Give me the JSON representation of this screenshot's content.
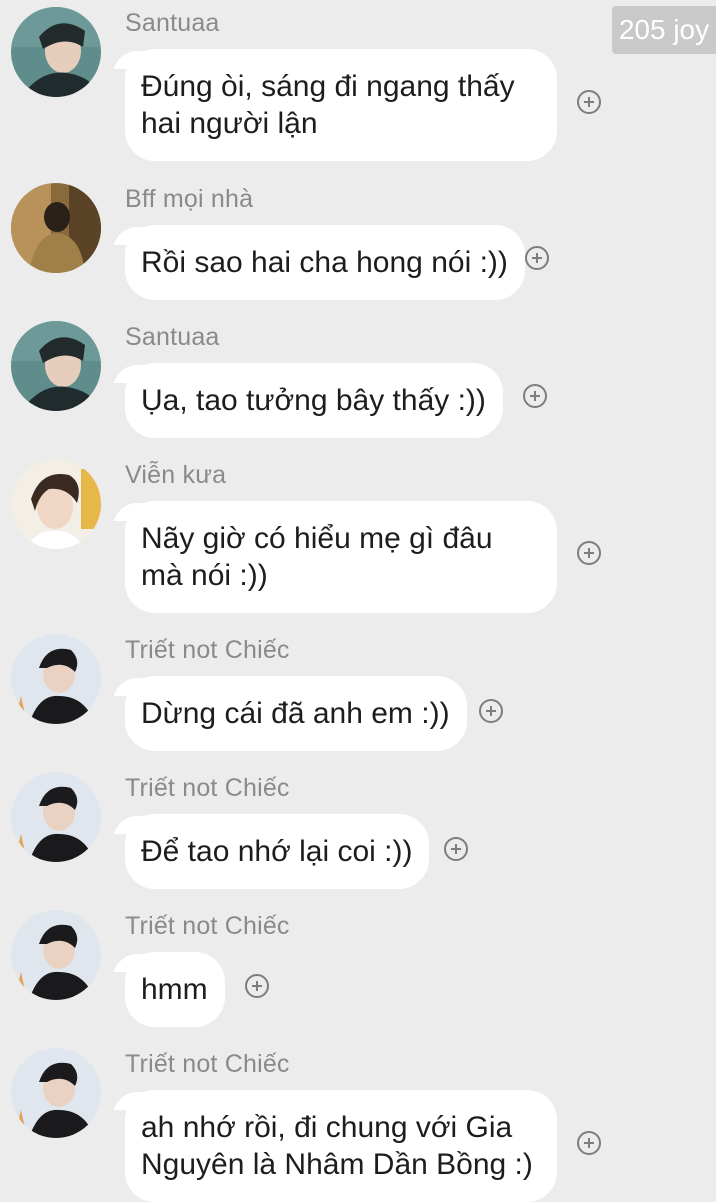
{
  "watermark": "205 joy",
  "messages": [
    {
      "sender": "Santuaa",
      "text": "Đúng òi, sáng đi ngang thấy hai người lận",
      "avatar": "santuaa-avatar"
    },
    {
      "sender": "Bff mọi nhà",
      "text": "Rồi sao hai cha hong nói :))",
      "avatar": "bff-avatar"
    },
    {
      "sender": "Santuaa",
      "text": "Ụa, tao tưởng bây thấy :))",
      "avatar": "santuaa-avatar"
    },
    {
      "sender": "Viễn kưa",
      "text": "Nãy giờ có hiểu mẹ gì đâu mà nói :))",
      "avatar": "vien-avatar"
    },
    {
      "sender": "Triết not Chiếc",
      "text": "Dừng cái đã anh em :))",
      "avatar": "triet-avatar"
    },
    {
      "sender": "Triết not Chiếc",
      "text": "Để tao nhớ lại coi :))",
      "avatar": "triet-avatar"
    },
    {
      "sender": "Triết not Chiếc",
      "text": "hmm",
      "avatar": "triet-avatar"
    },
    {
      "sender": "Triết not Chiếc",
      "text": "ah nhớ rồi, đi chung với Gia Nguyên là Nhâm Dần Bồng :)",
      "avatar": "triet-avatar"
    }
  ]
}
